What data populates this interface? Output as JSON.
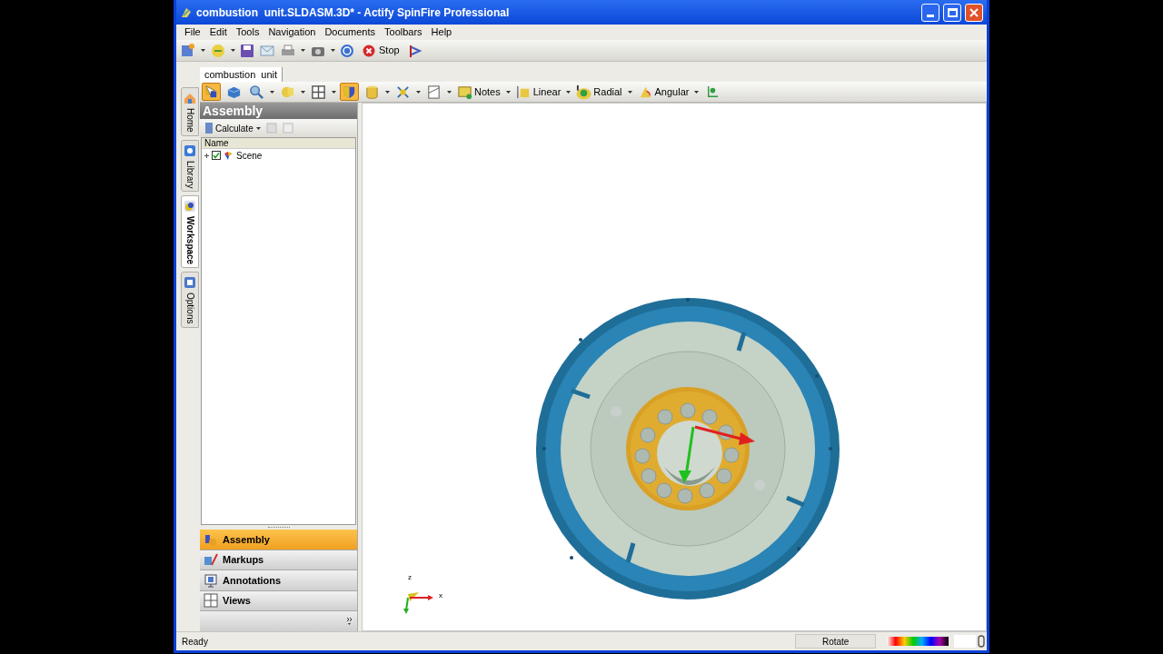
{
  "window": {
    "title": "combustion  unit.SLDASM.3D* - Actify SpinFire Professional"
  },
  "menu": [
    "File",
    "Edit",
    "Tools",
    "Navigation",
    "Documents",
    "Toolbars",
    "Help"
  ],
  "toolbar": {
    "stop_label": "Stop"
  },
  "document_tab": {
    "label": "combustion  unit",
    "selected": true
  },
  "side_tabs": [
    {
      "label": "Home",
      "selected": false
    },
    {
      "label": "Library",
      "selected": false
    },
    {
      "label": "Workspace",
      "selected": true
    },
    {
      "label": "Options",
      "selected": false
    }
  ],
  "view_toolbar": [
    {
      "selected": true
    },
    {
      "selected": false
    },
    {
      "selected": false
    },
    {
      "selected": false
    },
    {
      "selected": false
    },
    {
      "selected": true
    },
    {
      "selected": false
    },
    {
      "selected": false
    },
    {
      "selected": false
    },
    {
      "label": "Notes",
      "selected": false
    },
    {
      "label": "Linear",
      "selected": false
    },
    {
      "label": "Radial",
      "selected": false
    },
    {
      "label": "Angular",
      "selected": false
    },
    {
      "selected": false
    }
  ],
  "panel": {
    "title": "Assembly",
    "calculate_label": "Calculate",
    "column": "Name",
    "tree": [
      {
        "label": "Scene",
        "checked": true,
        "expanded": false
      }
    ]
  },
  "nav_buttons": [
    {
      "label": "Assembly",
      "selected": true
    },
    {
      "label": "Markups",
      "selected": false
    },
    {
      "label": "Annotations",
      "selected": false
    },
    {
      "label": "Views",
      "selected": false
    }
  ],
  "triad": {
    "z": "z",
    "x": "x"
  },
  "status_bar": {
    "message": "Ready",
    "mode": "Rotate"
  }
}
